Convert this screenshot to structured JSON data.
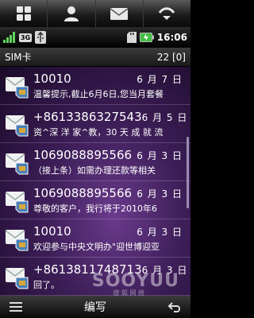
{
  "topbar": {
    "items": [
      {
        "icon": "apps-grid-icon"
      },
      {
        "icon": "contacts-icon"
      },
      {
        "icon": "messages-icon"
      },
      {
        "icon": "signal-dial-icon"
      }
    ]
  },
  "statusbar": {
    "network": "3G",
    "time": "16:06"
  },
  "folder": {
    "title": "SIM卡",
    "count": "22 [0]"
  },
  "messages": [
    {
      "sender": "10010",
      "date": "6 月 7 日",
      "preview": "温馨提示,截止6月6日,您当月套餐"
    },
    {
      "sender": "+8613386327543",
      "date": "6 月 5 日",
      "preview": "资^深 洋 家^教，30 天 成 就 流"
    },
    {
      "sender": "1069088895566",
      "date": "6 月 3 日",
      "preview": "（接上条）如需办理还款等相关"
    },
    {
      "sender": "1069088895566",
      "date": "6 月 3 日",
      "preview": "尊敬的客户，我行将于2010年6"
    },
    {
      "sender": "10010",
      "date": "6 月 3 日",
      "preview": "欢迎参与中央文明办\"迎世博迎亚"
    },
    {
      "sender": "+8613811748713",
      "date": "6 月 3 日",
      "preview": "回了。"
    }
  ],
  "watermark": {
    "brand": "SOOYUU",
    "sub": "搜 狐 网 络"
  },
  "bottombar": {
    "compose_label": "编写"
  }
}
